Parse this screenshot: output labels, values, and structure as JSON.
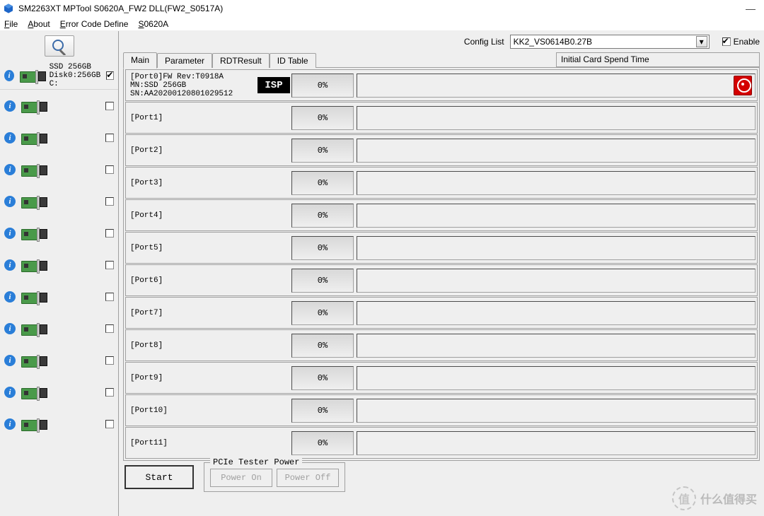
{
  "window": {
    "title": "SM2263XT MPTool S0620A_FW2     DLL(FW2_S0517A)"
  },
  "menu": {
    "file": "File",
    "about": "About",
    "error_code": "Error Code Define",
    "version": "S0620A"
  },
  "config": {
    "label": "Config List",
    "selected": "KK2_VS0614B0.27B",
    "enable_label": "Enable"
  },
  "tabs": {
    "main": "Main",
    "parameter": "Parameter",
    "rdt": "RDTResult",
    "idtable": "ID Table"
  },
  "subheader": "Initial Card Spend Time",
  "left_top": {
    "line1": "SSD 256GB",
    "line2": "Disk0:256GB",
    "line3": "C:"
  },
  "ports": [
    {
      "label": "[Port0]FW Rev:T0918A\nMN:SSD 256GB\nSN:AA20200120801029512",
      "isp": "ISP",
      "progress": "0%",
      "hdd": true
    },
    {
      "label": "[Port1]",
      "progress": "0%"
    },
    {
      "label": "[Port2]",
      "progress": "0%"
    },
    {
      "label": "[Port3]",
      "progress": "0%"
    },
    {
      "label": "[Port4]",
      "progress": "0%"
    },
    {
      "label": "[Port5]",
      "progress": "0%"
    },
    {
      "label": "[Port6]",
      "progress": "0%"
    },
    {
      "label": "[Port7]",
      "progress": "0%"
    },
    {
      "label": "[Port8]",
      "progress": "0%"
    },
    {
      "label": "[Port9]",
      "progress": "0%"
    },
    {
      "label": "[Port10]",
      "progress": "0%"
    },
    {
      "label": "[Port11]",
      "progress": "0%"
    }
  ],
  "footer": {
    "start": "Start",
    "group": "PCIe Tester Power",
    "poweron": "Power On",
    "poweroff": "Power Off"
  },
  "watermark": {
    "badge": "值",
    "text": "什么值得买"
  }
}
